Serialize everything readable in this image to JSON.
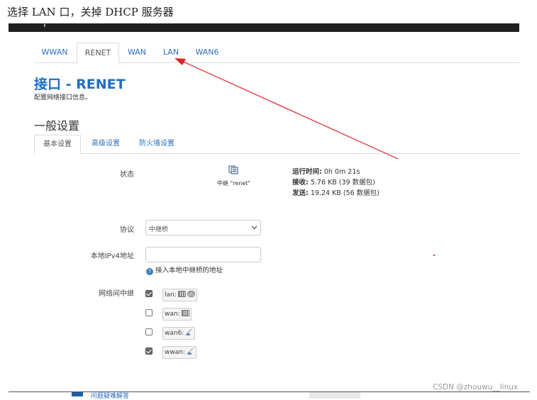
{
  "caption": "选择 LAN 口，关掉 DHCP 服务器",
  "tabs": [
    {
      "label": "WWAN",
      "active": false
    },
    {
      "label": "RENET",
      "active": true
    },
    {
      "label": "WAN",
      "active": false
    },
    {
      "label": "LAN",
      "active": false
    },
    {
      "label": "WAN6",
      "active": false
    }
  ],
  "page": {
    "title": "接口 - RENET",
    "subtitle": "配置网络接口信息。"
  },
  "section": "一般设置",
  "subtabs": [
    {
      "label": "基本设置",
      "active": true
    },
    {
      "label": "高级设置",
      "active": false
    },
    {
      "label": "防火墙设置",
      "active": false
    }
  ],
  "status": {
    "label": "状态",
    "iface_name": "中继 \"renet\"",
    "uptime_label": "运行时间:",
    "uptime_value": "0h 0m 21s",
    "rx_label": "接收:",
    "rx_value": "5.76 KB (39 数据包)",
    "tx_label": "发送:",
    "tx_value": "19.24 KB (56 数据包)"
  },
  "protocol": {
    "label": "协议",
    "value": "中继桥"
  },
  "ipv4": {
    "label": "本地IPv4地址",
    "value": "",
    "hint": "接入本地中继桥的地址",
    "hint_icon": "?"
  },
  "relay": {
    "label": "网络间中继",
    "items": [
      {
        "name": "lan:",
        "checked": true,
        "icons": [
          "ethernet-icon",
          "globe-icon"
        ]
      },
      {
        "name": "wan:",
        "checked": false,
        "icons": [
          "ethernet-icon"
        ]
      },
      {
        "name": "wan6:",
        "checked": false,
        "icons": [
          "wifi-icon"
        ]
      },
      {
        "name": "wwan:",
        "checked": true,
        "icons": [
          "wifi-icon"
        ]
      }
    ]
  },
  "footer": {
    "link": "问题疑难解答"
  },
  "watermark": "CSDN @zhouwu__linux",
  "colors": {
    "accent": "#1e6fc4",
    "link": "#2a6fbf",
    "annotation": "#e02020",
    "topbar": "#1f1f1f"
  }
}
